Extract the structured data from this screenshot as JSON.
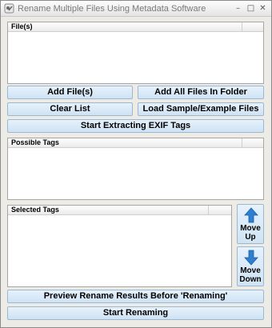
{
  "window": {
    "title": "Rename Multiple Files Using Metadata Software",
    "controls": [
      "–",
      "□",
      "✕"
    ]
  },
  "files_list": {
    "header": "File(s)"
  },
  "buttons": {
    "add_files": "Add File(s)",
    "add_all_files_in_folder": "Add All Files In Folder",
    "clear_list": "Clear List",
    "load_sample": "Load Sample/Example Files",
    "start_extracting": "Start Extracting EXIF Tags",
    "preview_rename": "Preview Rename Results Before 'Renaming'",
    "start_renaming": "Start Renaming"
  },
  "possible_tags_list": {
    "header": "Possible Tags"
  },
  "selected_tags_list": {
    "header": "Selected Tags"
  },
  "move_up": {
    "line1": "Move",
    "line2": "Up"
  },
  "move_down": {
    "line1": "Move",
    "line2": "Down"
  },
  "colors": {
    "button_top": "#e6f2fc",
    "button_bottom": "#cfe3f4",
    "arrow": "#2f7fd0"
  },
  "icons": [
    "app-icon",
    "minimize-icon",
    "maximize-icon",
    "close-icon",
    "arrow-up-icon",
    "arrow-down-icon"
  ]
}
